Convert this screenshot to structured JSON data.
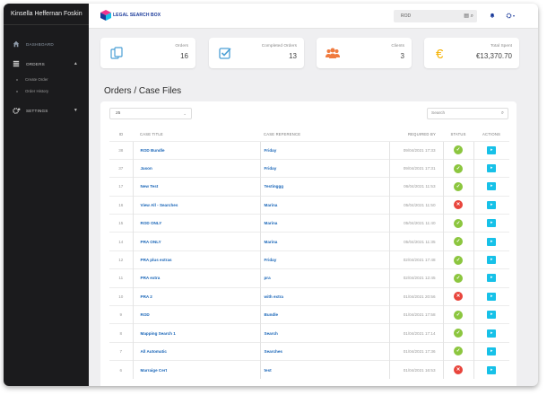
{
  "sidebar": {
    "user_name": "Kinsella Heffernan Foskin",
    "items": [
      {
        "label": "DASHBOARD",
        "icon": "home-icon"
      },
      {
        "label": "ORDERS",
        "icon": "orders-icon"
      },
      {
        "label": "SETTINGS",
        "icon": "gear-icon"
      }
    ],
    "sub_items": [
      "Create Order",
      "Order History"
    ]
  },
  "topbar": {
    "logo_text": "LEGAL SEARCH BOX",
    "search_value": "ROD"
  },
  "cards": [
    {
      "label": "Orders",
      "value": "16",
      "icon": "document-icon",
      "color": "#4b9fd5"
    },
    {
      "label": "Completed Orders",
      "value": "13",
      "icon": "checkbox-icon",
      "color": "#4b9fd5"
    },
    {
      "label": "Clients",
      "value": "3",
      "icon": "users-icon",
      "color": "#f07b3f"
    },
    {
      "label": "Total Spent",
      "value": "€13,370.70",
      "icon": "euro-icon",
      "color": "#f5b100"
    }
  ],
  "page_title": "Orders / Case Files",
  "table": {
    "page_size": "25",
    "search_placeholder": "Search",
    "headers": {
      "id": "ID",
      "title": "CASE TITLE",
      "ref": "CASE REFERENCE",
      "date": "REQUIRED BY",
      "status": "STATUS",
      "actions": "ACTIONS"
    },
    "rows": [
      {
        "id": "38",
        "title": "ROD Bundle",
        "ref": "Friday",
        "date": "09/04/2021 17:33",
        "status": "ok"
      },
      {
        "id": "37",
        "title": "Jason",
        "ref": "Friday",
        "date": "09/04/2021 17:31",
        "status": "ok"
      },
      {
        "id": "17",
        "title": "New Test",
        "ref": "Testinggg",
        "date": "06/04/2021 11:53",
        "status": "ok"
      },
      {
        "id": "16",
        "title": "View All - Searches",
        "ref": "Marina",
        "date": "05/04/2021 11:50",
        "status": "no"
      },
      {
        "id": "15",
        "title": "ROD ONLY",
        "ref": "Marina",
        "date": "05/04/2021 11:40",
        "status": "ok"
      },
      {
        "id": "14",
        "title": "PRA ONLY",
        "ref": "Marina",
        "date": "05/04/2021 11:35",
        "status": "ok"
      },
      {
        "id": "12",
        "title": "PRA plus extras",
        "ref": "Friday",
        "date": "02/04/2021 17:48",
        "status": "ok"
      },
      {
        "id": "11",
        "title": "PRA extra",
        "ref": "pra",
        "date": "02/04/2021 12:45",
        "status": "ok"
      },
      {
        "id": "10",
        "title": "PRA 2",
        "ref": "with extra",
        "date": "01/04/2021 20:56",
        "status": "no"
      },
      {
        "id": "9",
        "title": "ROD",
        "ref": "Bundle",
        "date": "01/04/2021 17:58",
        "status": "ok"
      },
      {
        "id": "8",
        "title": "Mapping Search 1",
        "ref": "Search",
        "date": "01/04/2021 17:14",
        "status": "ok"
      },
      {
        "id": "7",
        "title": "All Automatic",
        "ref": "Searches",
        "date": "01/04/2021 17:36",
        "status": "ok"
      },
      {
        "id": "6",
        "title": "Marraige Cert",
        "ref": "test",
        "date": "01/04/2021 16:53",
        "status": "no"
      }
    ]
  }
}
